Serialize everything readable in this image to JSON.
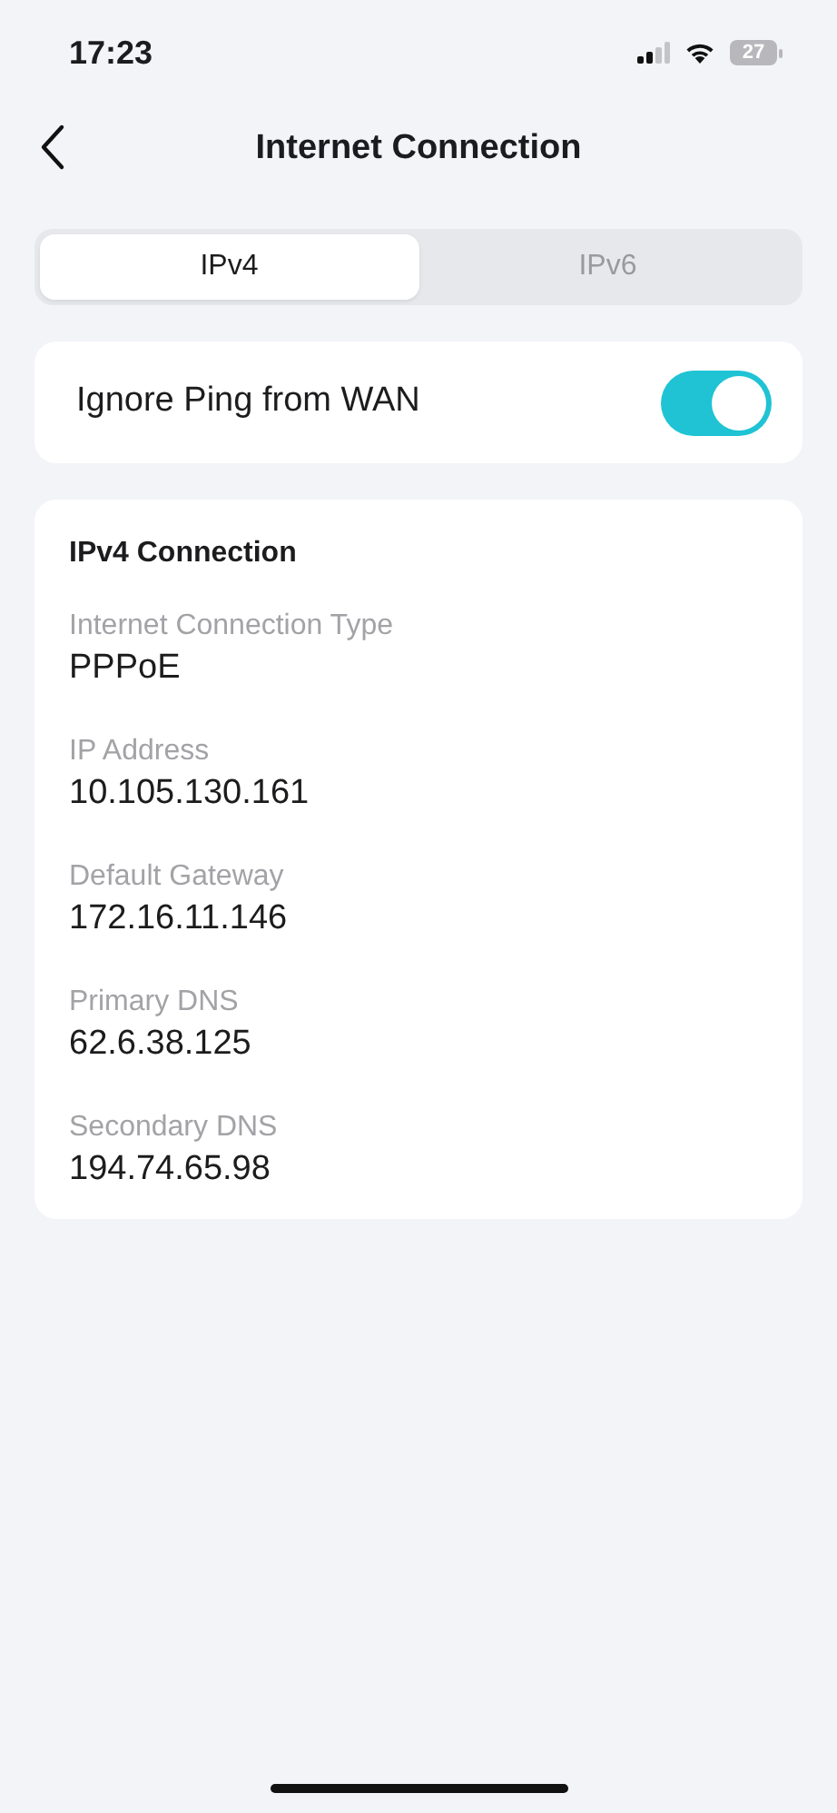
{
  "status_bar": {
    "time": "17:23",
    "battery": "27"
  },
  "nav": {
    "title": "Internet Connection"
  },
  "tabs": [
    {
      "label": "IPv4",
      "selected": true
    },
    {
      "label": "IPv6",
      "selected": false
    }
  ],
  "toggle": {
    "label": "Ignore Ping from WAN",
    "on": true
  },
  "connection": {
    "title": "IPv4 Connection",
    "fields": [
      {
        "label": "Internet Connection Type",
        "value": "PPPoE"
      },
      {
        "label": "IP Address",
        "value": "10.105.130.161"
      },
      {
        "label": "Default Gateway",
        "value": "172.16.11.146"
      },
      {
        "label": "Primary DNS",
        "value": "62.6.38.125"
      },
      {
        "label": "Secondary DNS",
        "value": "194.74.65.98"
      }
    ]
  }
}
